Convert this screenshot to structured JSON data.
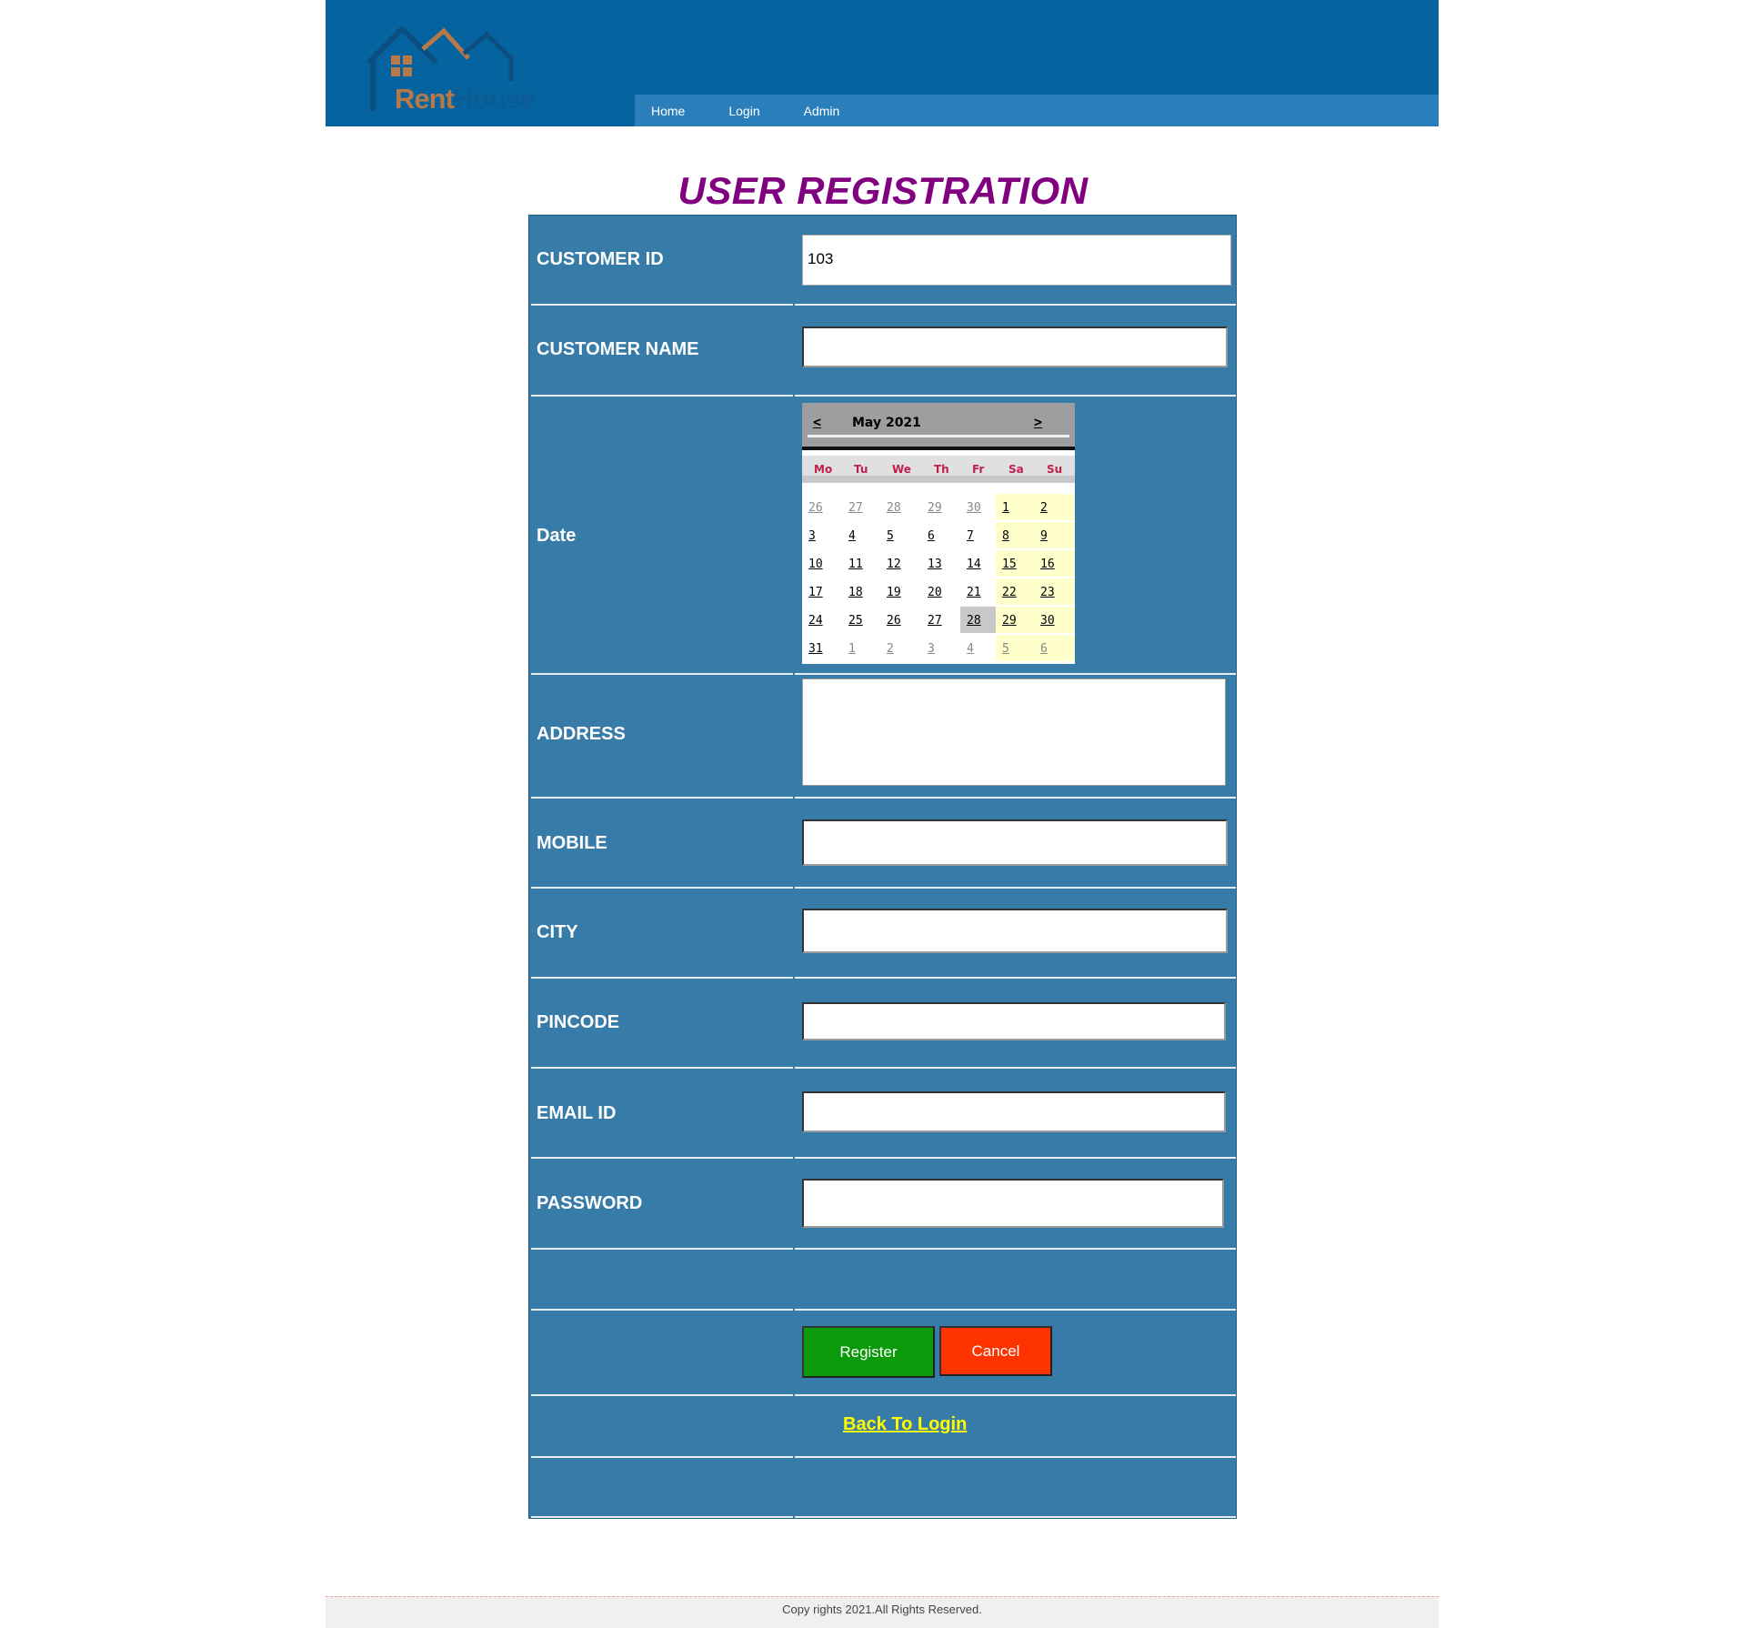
{
  "brand": {
    "word1": "Rent",
    "word2": "House"
  },
  "nav": {
    "items": [
      "Home",
      "Login",
      "Admin"
    ]
  },
  "page_title": "USER REGISTRATION",
  "form": {
    "customer_id": {
      "label": "CUSTOMER ID",
      "value": "103"
    },
    "customer_name": {
      "label": "CUSTOMER NAME",
      "value": ""
    },
    "date": {
      "label": "Date"
    },
    "address": {
      "label": "ADDRESS",
      "value": ""
    },
    "mobile": {
      "label": "MOBILE",
      "value": ""
    },
    "city": {
      "label": "CITY",
      "value": ""
    },
    "pincode": {
      "label": "PINCODE",
      "value": ""
    },
    "email": {
      "label": "EMAIL ID",
      "value": ""
    },
    "password": {
      "label": "PASSWORD",
      "value": ""
    }
  },
  "calendar": {
    "title": "May 2021",
    "prev": "<",
    "next": ">",
    "weekdays": [
      "Mo",
      "Tu",
      "We",
      "Th",
      "Fr",
      "Sa",
      "Su"
    ],
    "selected_day": "28",
    "weeks": [
      [
        "26",
        "27",
        "28",
        "29",
        "30",
        "1",
        "2"
      ],
      [
        "3",
        "4",
        "5",
        "6",
        "7",
        "8",
        "9"
      ],
      [
        "10",
        "11",
        "12",
        "13",
        "14",
        "15",
        "16"
      ],
      [
        "17",
        "18",
        "19",
        "20",
        "21",
        "22",
        "23"
      ],
      [
        "24",
        "25",
        "26",
        "27",
        "28",
        "29",
        "30"
      ],
      [
        "31",
        "1",
        "2",
        "3",
        "4",
        "5",
        "6"
      ]
    ]
  },
  "buttons": {
    "register": "Register",
    "cancel": "Cancel"
  },
  "back_link": "Back To Login",
  "footer": "Copy rights 2021.All Rights Reserved.",
  "colors": {
    "header": "#0563a0",
    "nav": "#2a7fbb",
    "form_bg": "#377ba8",
    "title": "#800080",
    "register": "#0a9a0a",
    "cancel": "#ff3300",
    "link": "#ffff00"
  }
}
